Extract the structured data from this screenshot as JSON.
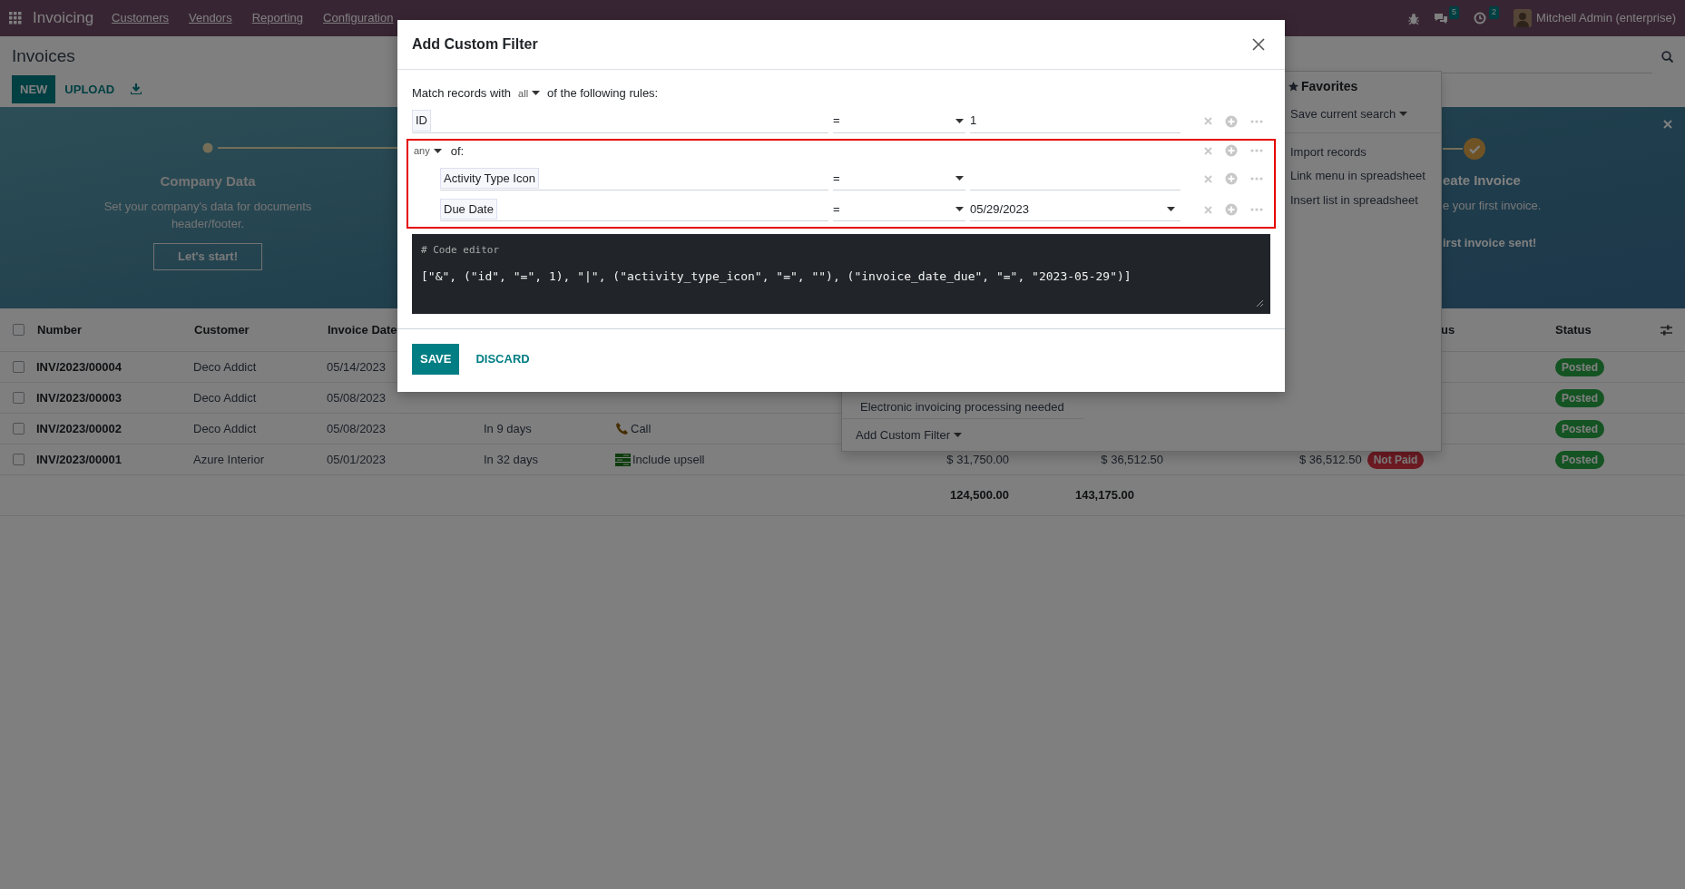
{
  "navbar": {
    "app": "Invoicing",
    "menu": [
      "Customers",
      "Vendors",
      "Reporting",
      "Configuration"
    ],
    "chat_count": "5",
    "activity_count": "2",
    "user": "Mitchell Admin (enterprise)"
  },
  "control_panel": {
    "breadcrumb": "Invoices",
    "buttons": [
      "NEW",
      "UPLOAD"
    ]
  },
  "onboarding": {
    "steps": [
      {
        "title": "Company Data",
        "description": "Set your company's data for documents header/footer.",
        "button": "Let's start!",
        "done": false
      },
      {
        "title": "eate Invoice",
        "description": "e your first invoice.",
        "note": "irst invoice sent!",
        "done": true
      }
    ]
  },
  "table": {
    "all_selected": false,
    "columns": [
      "Number",
      "Customer",
      "Invoice Date",
      "us",
      "Status"
    ],
    "rows": [
      {
        "selected": false,
        "number": "INV/2023/00004",
        "customer": "Deco Addict",
        "invoice_date": "05/14/2023",
        "status": "Posted"
      },
      {
        "selected": false,
        "number": "INV/2023/00003",
        "customer": "Deco Addict",
        "invoice_date": "05/08/2023",
        "status": "Posted"
      },
      {
        "selected": false,
        "number": "INV/2023/00002",
        "customer": "Deco Addict",
        "invoice_date": "05/08/2023",
        "due": "In 9 days",
        "activity": {
          "kind": "phone",
          "text": "Call"
        },
        "status": "Posted"
      },
      {
        "selected": false,
        "number": "INV/2023/00001",
        "customer": "Azure Interior",
        "invoice_date": "05/01/2023",
        "due": "In 32 days",
        "activity": {
          "kind": "upsell",
          "text": "Include upsell"
        },
        "untaxed": "$ 31,750.00",
        "total": "$ 36,512.50",
        "residual": "$ 36,512.50",
        "payment_state": "Not Paid",
        "status": "Posted"
      }
    ],
    "totals": [
      "124,500.00",
      "143,175.00"
    ]
  },
  "filter_menu": {
    "filters": [
      "Electronic invoicing processing needed"
    ],
    "add_custom_filter": "Add Custom Filter",
    "favorites_title": "Favorites",
    "save_search": "Save current search",
    "actions": [
      "Import records",
      "Link menu in spreadsheet",
      "Insert list in spreadsheet"
    ]
  },
  "dialog": {
    "title": "Add Custom Filter",
    "match_prefix": "Match records with",
    "match_mode": "all",
    "match_suffix": "of the following rules:",
    "rules": [
      {
        "kind": "condition",
        "field": "ID",
        "operator": "=",
        "value": "1"
      },
      {
        "kind": "group",
        "mode": "any",
        "suffix": "of:",
        "highlighted": true,
        "children": [
          {
            "kind": "condition",
            "field": "Activity Type Icon",
            "operator": "="
          },
          {
            "kind": "condition",
            "field": "Due Date",
            "operator": "=",
            "value": "05/29/2023",
            "date_picker": true
          }
        ]
      }
    ],
    "code_comment": "# Code editor",
    "code": "[\"&\", (\"id\", \"=\", 1), \"|\", (\"activity_type_icon\", \"=\", \"\"), (\"invoice_date_due\", \"=\", \"2023-05-29\")]",
    "buttons": [
      "SAVE",
      "DISCARD"
    ]
  }
}
